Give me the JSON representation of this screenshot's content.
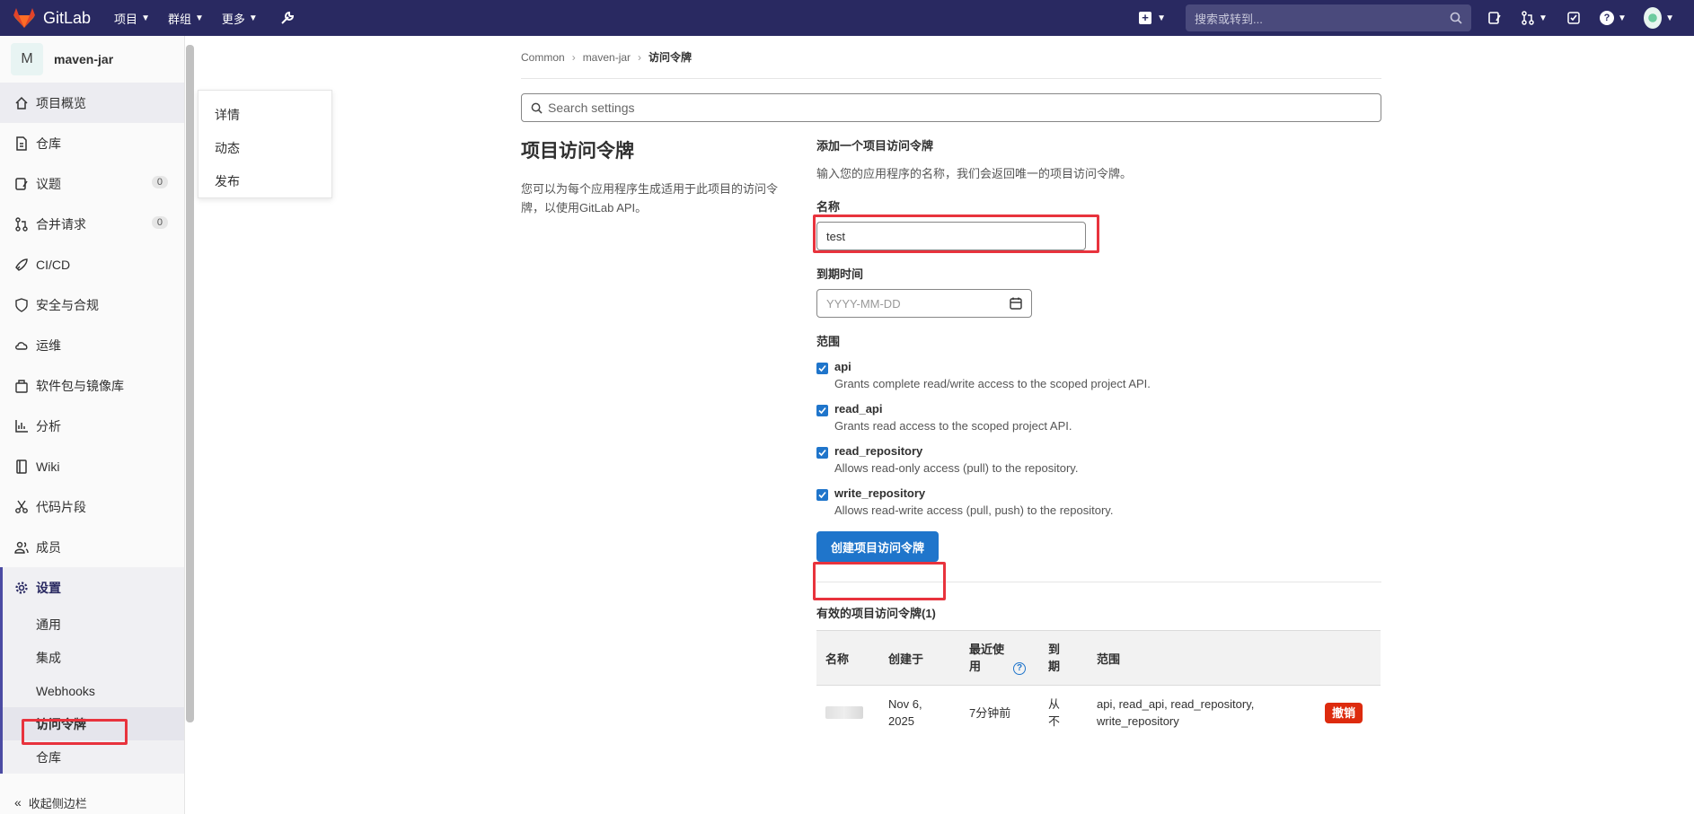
{
  "topbar": {
    "brand": "GitLab",
    "menus": [
      {
        "label": "项目"
      },
      {
        "label": "群组"
      },
      {
        "label": "更多"
      }
    ],
    "search_placeholder": "搜索或转到..."
  },
  "sidebar": {
    "project_initial": "M",
    "project_name": "maven-jar",
    "items": [
      {
        "label": "项目概览",
        "icon": "home-icon"
      },
      {
        "label": "仓库",
        "icon": "doc-icon"
      },
      {
        "label": "议题",
        "icon": "issues-icon",
        "badge": "0"
      },
      {
        "label": "合并请求",
        "icon": "merge-request-icon",
        "badge": "0"
      },
      {
        "label": "CI/CD",
        "icon": "rocket-icon"
      },
      {
        "label": "安全与合规",
        "icon": "shield-icon"
      },
      {
        "label": "运维",
        "icon": "cloud-icon"
      },
      {
        "label": "软件包与镜像库",
        "icon": "package-icon"
      },
      {
        "label": "分析",
        "icon": "chart-icon"
      },
      {
        "label": "Wiki",
        "icon": "book-icon"
      },
      {
        "label": "代码片段",
        "icon": "scissors-icon"
      },
      {
        "label": "成员",
        "icon": "users-icon"
      }
    ],
    "settings_label": "设置",
    "settings_sub": [
      "通用",
      "集成",
      "Webhooks",
      "访问令牌",
      "仓库"
    ],
    "collapse_label": "收起侧边栏"
  },
  "flyout": {
    "items": [
      "详情",
      "动态",
      "发布"
    ]
  },
  "breadcrumb": {
    "items": [
      "Common",
      "maven-jar",
      "访问令牌"
    ]
  },
  "settings_search_placeholder": "Search settings",
  "section": {
    "title": "项目访问令牌",
    "description": "您可以为每个应用程序生成适用于此项目的访问令牌，以使用GitLab API。"
  },
  "form": {
    "heading": "添加一个项目访问令牌",
    "description": "输入您的应用程序的名称，我们会返回唯一的项目访问令牌。",
    "name_label": "名称",
    "name_value": "test",
    "expiry_label": "到期时间",
    "expiry_placeholder": "YYYY-MM-DD",
    "scopes_label": "范围",
    "scopes": [
      {
        "name": "api",
        "desc": "Grants complete read/write access to the scoped project API.",
        "checked": true
      },
      {
        "name": "read_api",
        "desc": "Grants read access to the scoped project API.",
        "checked": true
      },
      {
        "name": "read_repository",
        "desc": "Allows read-only access (pull) to the repository.",
        "checked": true
      },
      {
        "name": "write_repository",
        "desc": "Allows read-write access (pull, push) to the repository.",
        "checked": true
      }
    ],
    "submit_label": "创建项目访问令牌"
  },
  "active_tokens": {
    "title": "有效的项目访问令牌(1)",
    "headers": [
      "名称",
      "创建于",
      "最近使用",
      "到期",
      "范围"
    ],
    "rows": [
      {
        "created": "Nov 6, 2025",
        "last_used": "7分钟前",
        "expires": "从不",
        "scopes": "api, read_api, read_repository, write_repository",
        "action": "撤销"
      }
    ]
  },
  "colors": {
    "navbar": "#292961",
    "primary": "#1f75cb",
    "danger": "#dd2b0e",
    "highlight": "#e8333d"
  }
}
